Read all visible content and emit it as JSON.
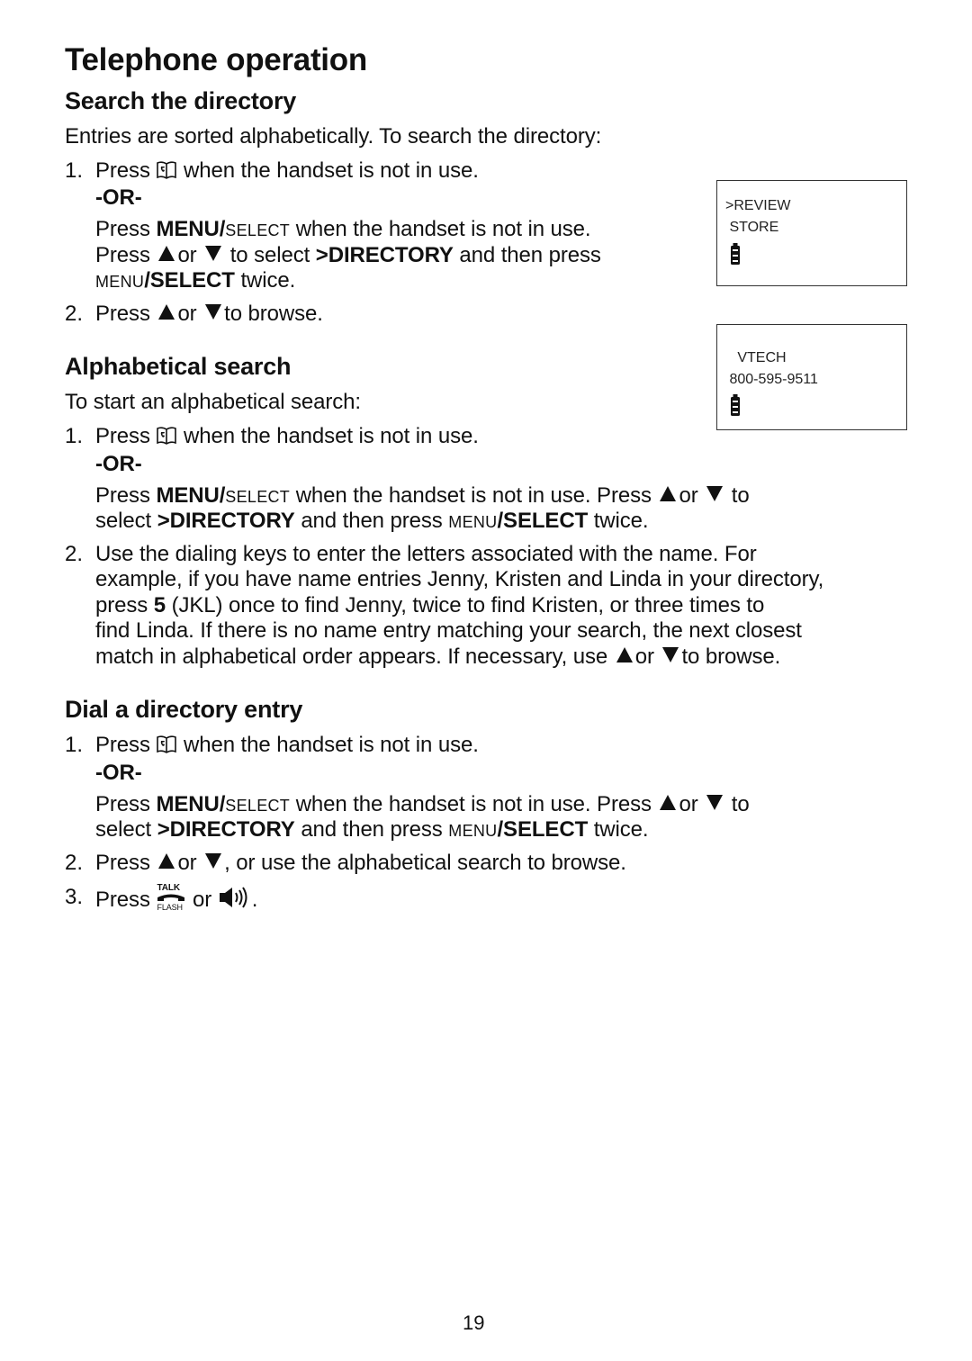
{
  "page": {
    "title": "Telephone operation",
    "page_number": "19"
  },
  "icons": {
    "directory": "directory-book-icon",
    "up": "up-arrow-icon",
    "down": "down-arrow-icon",
    "talk_flash": "talk-flash-icon",
    "speaker": "speaker-icon",
    "battery": "battery-icon"
  },
  "common": {
    "press": "Press",
    "or_word": "or",
    "or_sep": "-OR-",
    "menu": "MENU/",
    "select_sc": "SELECT",
    "menu_sc": "MENU",
    "select_b": "/SELECT",
    "directory": ">DIRECTORY",
    "not_in_use": "when the handset is not in use.",
    "twice": "twice."
  },
  "search": {
    "heading": "Search the directory",
    "intro": "Entries are sorted alphabetically. To search the directory:",
    "step1_num": "1.",
    "step1_alt_line2_a": "to select",
    "step1_alt_line2_b": "and then press",
    "step2_num": "2.",
    "step2_tail": "to browse."
  },
  "alpha": {
    "heading": "Alphabetical search",
    "intro": "To start an alphabetical search:",
    "step1_num": "1.",
    "step1_alt_a": "when the handset is not in use. Press",
    "to": "to",
    "select_word": "select",
    "then_press": "and then press",
    "step2_num": "2.",
    "step2_lines": [
      "Use the dialing keys to enter the letters associated with the name. For",
      "example, if you have name entries Jenny, Kristen and Linda in your directory,"
    ],
    "step2_l3_a": "press",
    "step2_l3_key": "5",
    "step2_l3_b": "(JKL) once to find Jenny, twice to find Kristen, or three times to",
    "step2_l4": "find Linda. If there is no name entry matching your search, the next closest",
    "step2_l5_a": "match in alphabetical order appears. If necessary, use",
    "step2_l5_b": "to browse."
  },
  "dial": {
    "heading": "Dial a directory entry",
    "step1_num": "1.",
    "step2_num": "2.",
    "step2_tail": ", or use the alphabetical search to browse.",
    "step3_num": "3.",
    "step3_end": "."
  },
  "screens": [
    {
      "line1": ">REVIEW",
      "line2": " STORE"
    },
    {
      "line1": "   VTECH",
      "line2": " 800-595-9511"
    }
  ],
  "talk_icon": {
    "top": "TALK",
    "bottom": "FLASH"
  }
}
